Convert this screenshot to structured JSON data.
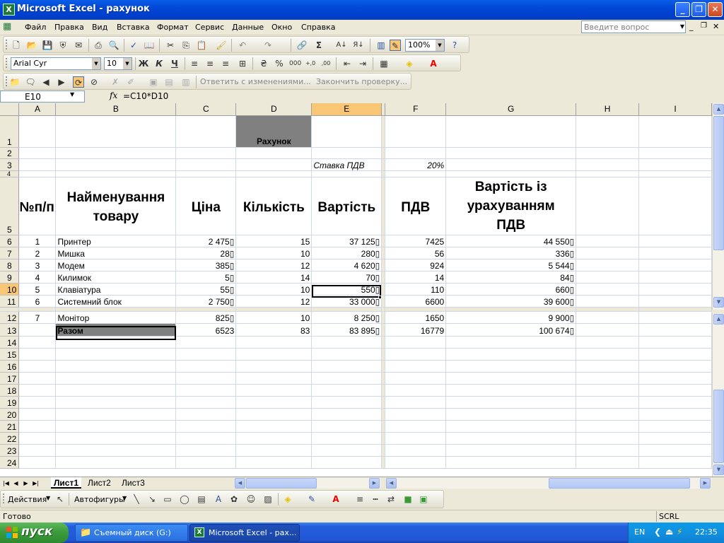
{
  "window": {
    "title": "Microsoft Excel - рахунок"
  },
  "menu": {
    "items": [
      "Файл",
      "Правка",
      "Вид",
      "Вставка",
      "Формат",
      "Сервис",
      "Данные",
      "Окно",
      "Справка"
    ],
    "help_placeholder": "Введите вопрос"
  },
  "toolbar": {
    "zoom": "100%",
    "font_name": "Arial Cyr",
    "font_size": "10",
    "reviewing_reply": "Ответить с изменениями...",
    "reviewing_end": "Закончить проверку..."
  },
  "formula_bar": {
    "name_box": "E10",
    "fx": "fx",
    "formula": "=C10*D10"
  },
  "columns": [
    "A",
    "B",
    "C",
    "D",
    "E",
    "F",
    "G",
    "H",
    "I"
  ],
  "rows": [
    "1",
    "2",
    "3",
    "4",
    "5",
    "6",
    "7",
    "8",
    "9",
    "10",
    "11",
    "12",
    "13",
    "14",
    "15",
    "16",
    "17",
    "18",
    "19",
    "20",
    "21",
    "22",
    "23",
    "24"
  ],
  "sheet": {
    "invoice_title": "Рахунок",
    "vat_label": "Ставка ПДВ",
    "vat_rate": "20%",
    "headers": {
      "num": "№п/п",
      "name": "Найменування товару",
      "price": "Ціна",
      "qty": "Кількість",
      "cost": "Вартість",
      "vat": "ПДВ",
      "total": "Вартість із урахуванням ПДВ"
    },
    "items": [
      {
        "n": "1",
        "name": "Принтер",
        "price": "2 475▯",
        "qty": "15",
        "cost": "37 125▯",
        "vat": "7425",
        "total": "44 550▯"
      },
      {
        "n": "2",
        "name": "Мишка",
        "price": "28▯",
        "qty": "10",
        "cost": "280▯",
        "vat": "56",
        "total": "336▯"
      },
      {
        "n": "3",
        "name": "Модем",
        "price": "385▯",
        "qty": "12",
        "cost": "4 620▯",
        "vat": "924",
        "total": "5 544▯"
      },
      {
        "n": "4",
        "name": "Килимок",
        "price": "5▯",
        "qty": "14",
        "cost": "70▯",
        "vat": "14",
        "total": "84▯"
      },
      {
        "n": "5",
        "name": "Клавіатура",
        "price": "55▯",
        "qty": "10",
        "cost": "550▯",
        "vat": "110",
        "total": "660▯"
      },
      {
        "n": "6",
        "name": "Системний блок",
        "price": "2 750▯",
        "qty": "12",
        "cost": "33 000▯",
        "vat": "6600",
        "total": "39 600▯"
      },
      {
        "n": "7",
        "name": "Монітор",
        "price": "825▯",
        "qty": "10",
        "cost": "8 250▯",
        "vat": "1650",
        "total": "9 900▯"
      }
    ],
    "total_row": {
      "label": "Разом",
      "price": "6523",
      "qty": "83",
      "cost": "83 895▯",
      "vat": "16779",
      "total": "100 674▯"
    }
  },
  "sheet_tabs": [
    "Лист1",
    "Лист2",
    "Лист3"
  ],
  "drawing_toolbar": {
    "actions": "Действия",
    "autoshapes": "Автофигуры"
  },
  "status": {
    "ready": "Готово",
    "scrl": "SCRL"
  },
  "taskbar": {
    "start": "пуск",
    "task1": "Съемный диск (G:)",
    "task2": "Microsoft Excel - рах...",
    "lang": "EN",
    "clock": "22:35"
  },
  "colors": {
    "title_bar": "#0147d6",
    "selected_header": "#f9c675",
    "title_cell_fill": "#808080",
    "total_cell_fill": "#808080"
  }
}
